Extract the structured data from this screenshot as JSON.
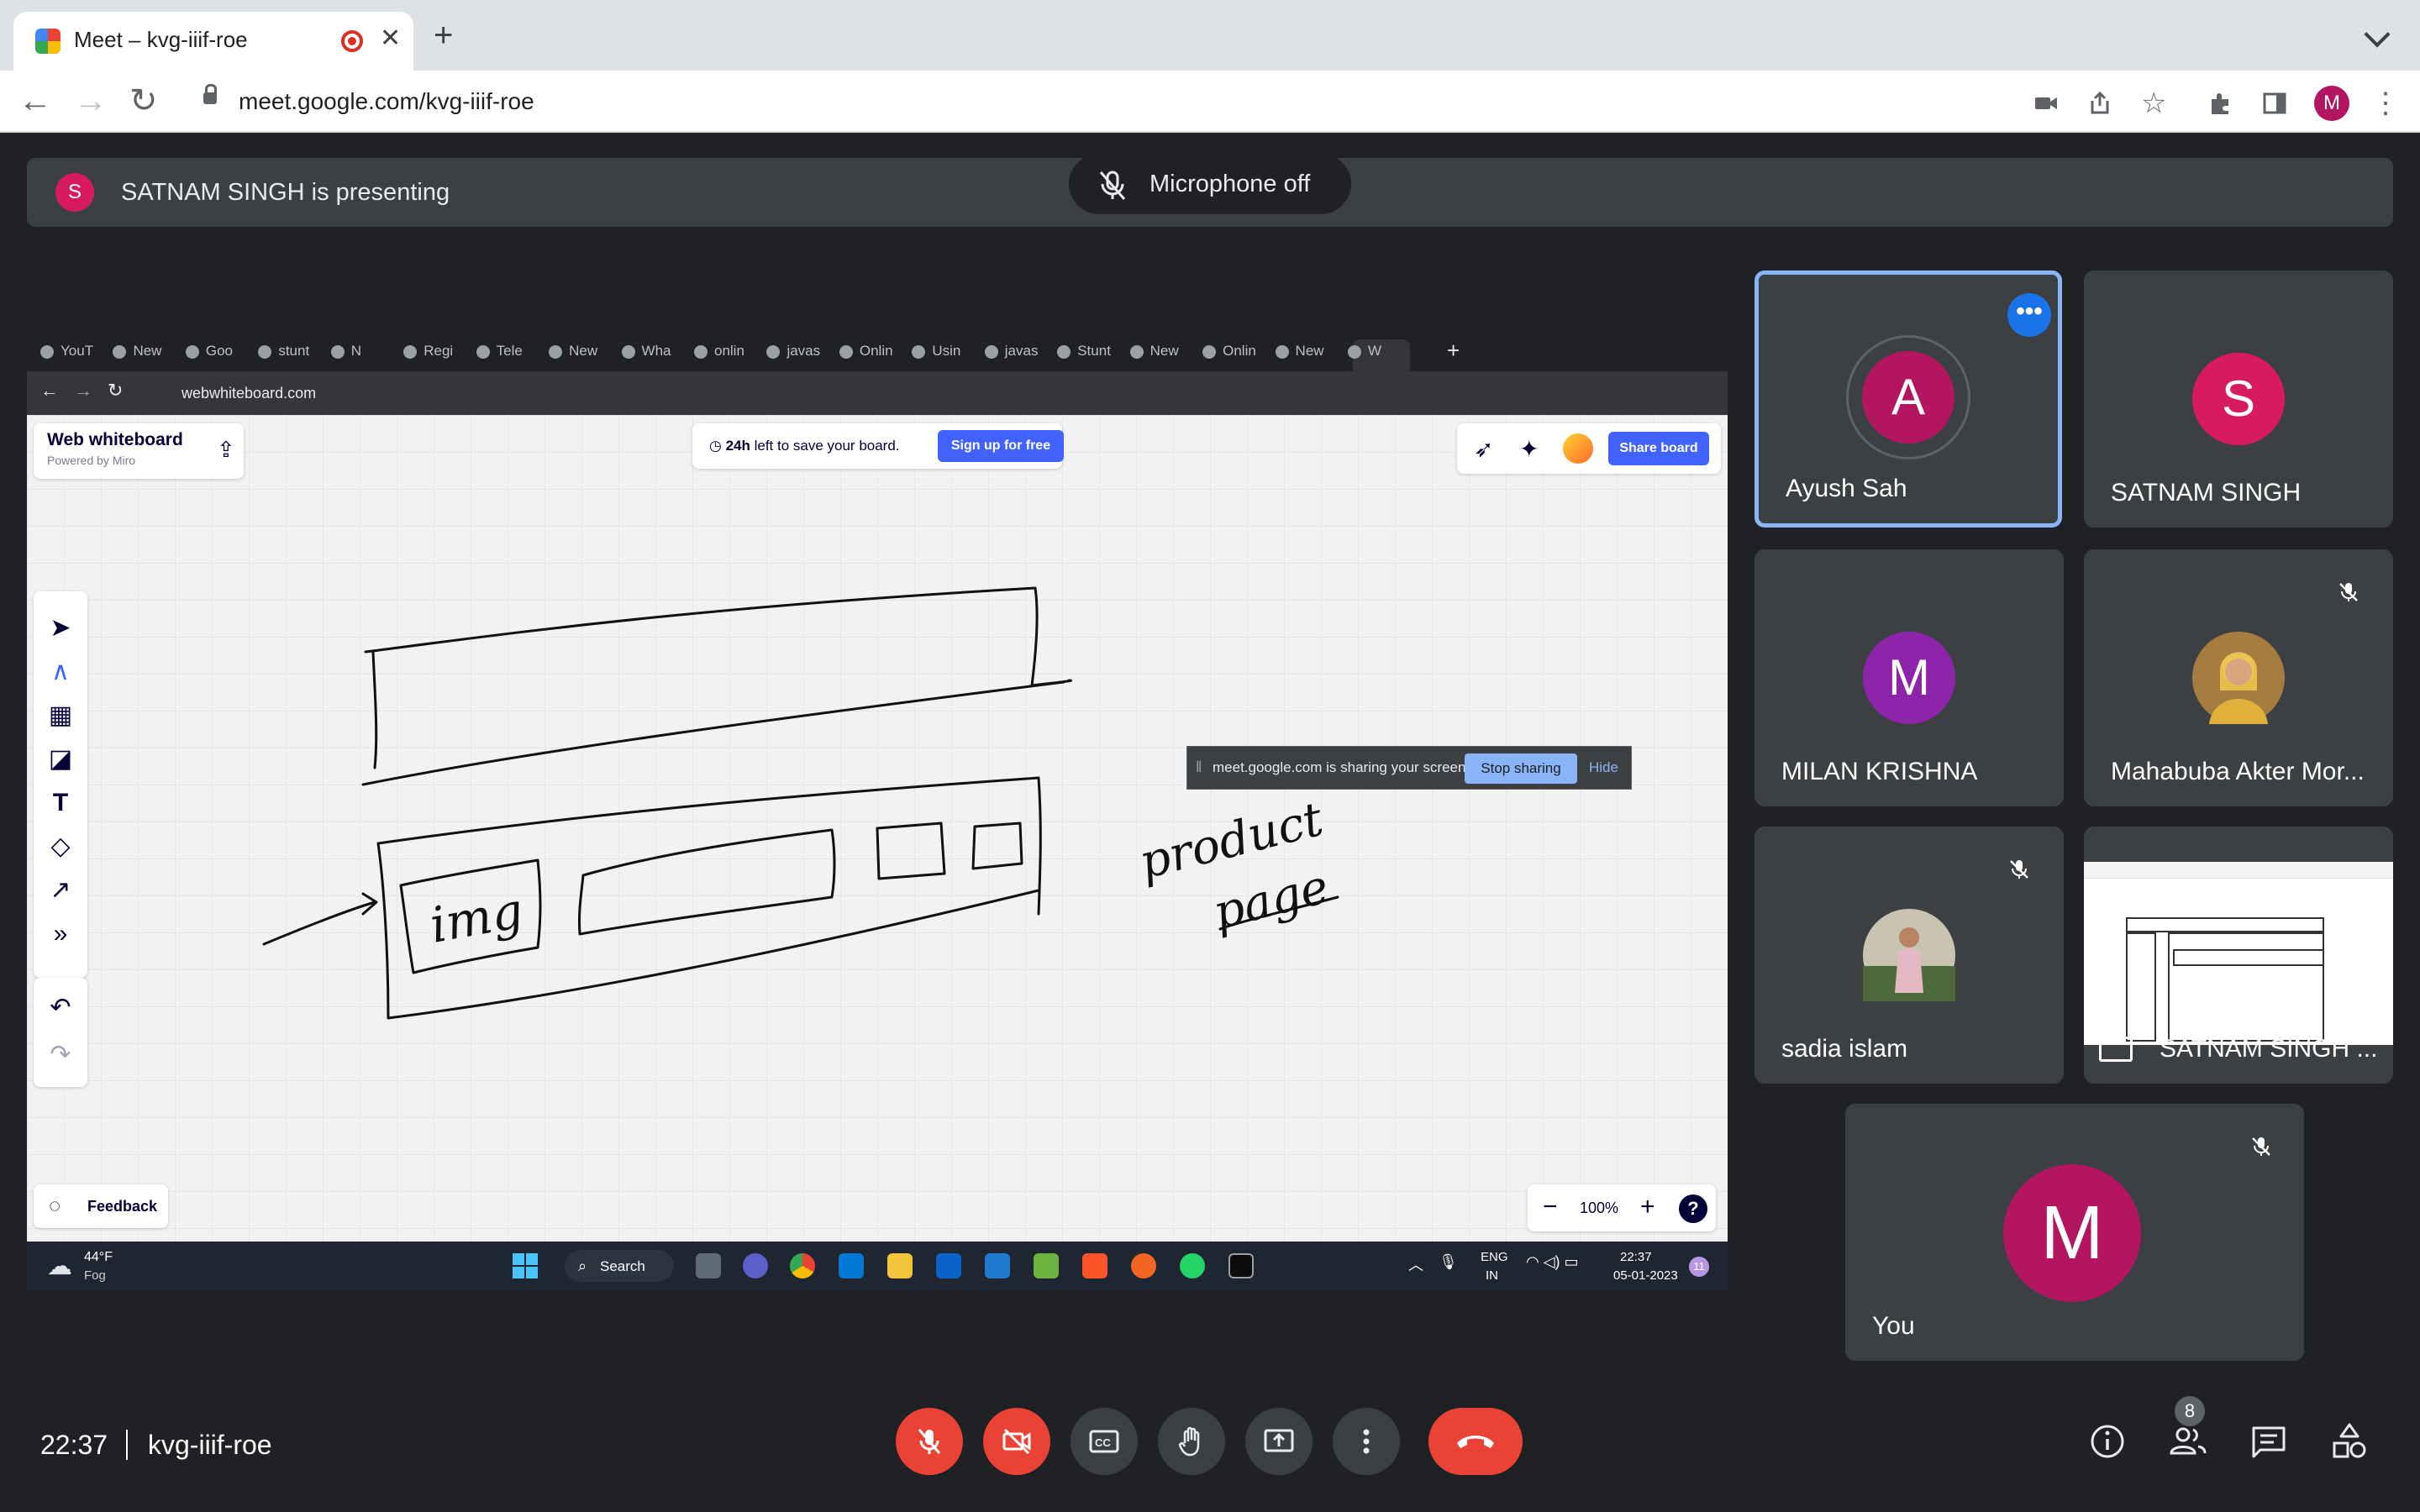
{
  "browser": {
    "tab_title": "Meet – kvg-iiif-roe",
    "url": "meet.google.com/kvg-iiif-roe",
    "profile_initial": "M"
  },
  "meet": {
    "presenting_initial": "S",
    "presenting_text": "SATNAM SINGH is presenting",
    "mic_toast": "Microphone off",
    "time": "22:37",
    "code": "kvg-iiif-roe",
    "people_count": "8",
    "participants": [
      {
        "name": "Ayush Sah",
        "initial": "A",
        "color": "#b31561"
      },
      {
        "name": "SATNAM SINGH",
        "initial": "S",
        "color": "#d81b60"
      },
      {
        "name": "MILAN KRISHNA",
        "initial": "M",
        "color": "#8e24aa"
      },
      {
        "name": "Mahabuba Akter Mor...",
        "initial": "",
        "color": "#b48a4a"
      },
      {
        "name": "sadia islam",
        "initial": "",
        "color": "#6d8a6a"
      },
      {
        "name": "SATNAM SINGH ...",
        "initial": "",
        "color": "#ffffff"
      },
      {
        "name": "You",
        "initial": "M",
        "color": "#b31561"
      }
    ]
  },
  "shared": {
    "tabs": [
      "YouT",
      "New",
      "Goo",
      "stunt",
      "N",
      "Regi",
      "Tele",
      "New",
      "Wha",
      "onlin",
      "javas",
      "Onlin",
      "Usin",
      "javas",
      "Stunt",
      "New",
      "Onlin",
      "New",
      "W"
    ],
    "url": "webwhiteboard.com",
    "wb_title": "Web whiteboard",
    "wb_sub": "Powered by Miro",
    "save_bold": "24h",
    "save_rest": "left to save your board.",
    "signup": "Sign up for free",
    "share_board": "Share board",
    "feedback": "Feedback",
    "zoom": "100%",
    "share_msg": "meet.google.com is sharing your screen.",
    "stop_sharing": "Stop sharing",
    "hide": "Hide",
    "drawing_img": "img",
    "drawing_note1": "product",
    "drawing_note2": "page",
    "weather_temp": "44°F",
    "weather_desc": "Fog",
    "search": "Search",
    "lang1": "ENG",
    "lang2": "IN",
    "tb_time": "22:37",
    "tb_date": "05-01-2023",
    "notif": "11"
  },
  "colors": {
    "meet_bg": "#202124",
    "tile_bg": "#3c4043",
    "red": "#ea4335",
    "active_border": "#8ab4f8",
    "miro_blue": "#4262ff"
  }
}
